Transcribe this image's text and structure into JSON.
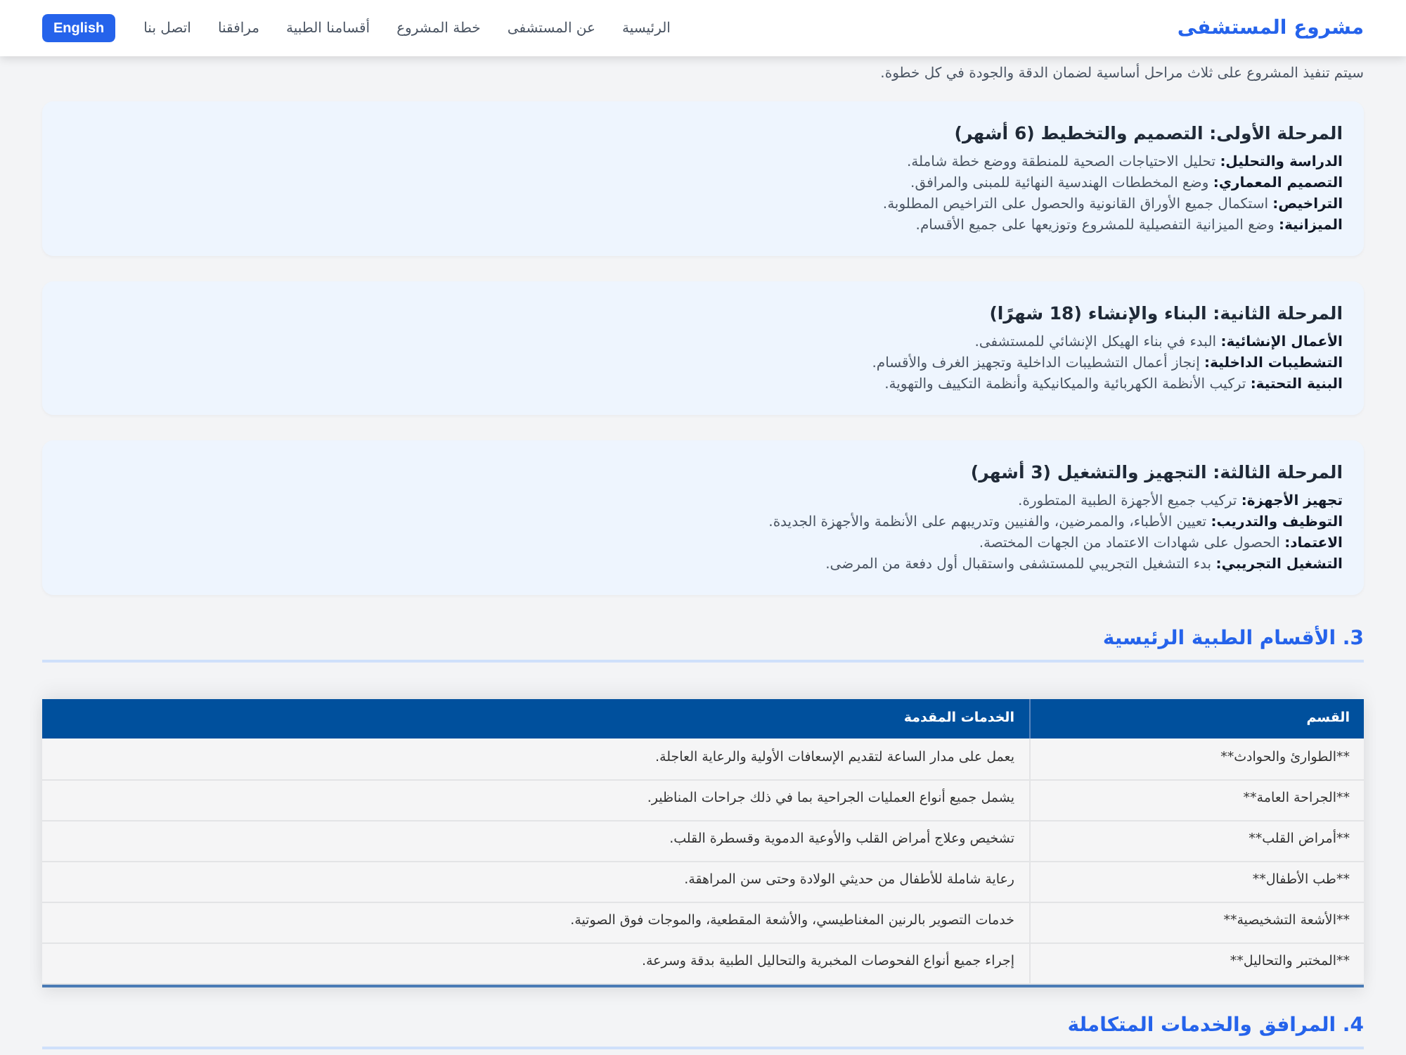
{
  "header": {
    "brand": "مشروع المستشفى",
    "nav": [
      "الرئيسية",
      "عن المستشفى",
      "خطة المشروع",
      "أقسامنا الطبية",
      "مرافقنا",
      "اتصل بنا"
    ],
    "language_button": "English"
  },
  "intro": "سيتم تنفيذ المشروع على ثلاث مراحل أساسية لضمان الدقة والجودة في كل خطوة.",
  "phases": [
    {
      "title": "المرحلة الأولى: التصميم والتخطيط (6 أشهر)",
      "tasks": [
        "**الدراسة والتحليل:** تحليل الاحتياجات الصحية للمنطقة ووضع خطة شاملة.",
        "**التصميم المعماري:** وضع المخططات الهندسية النهائية للمبنى والمرافق.",
        "**التراخيص:** استكمال جميع الأوراق القانونية والحصول على التراخيص المطلوبة.",
        "**الميزانية:** وضع الميزانية التفصيلية للمشروع وتوزيعها على جميع الأقسام."
      ]
    },
    {
      "title": "المرحلة الثانية: البناء والإنشاء (18 شهرًا)",
      "tasks": [
        "**الأعمال الإنشائية:** البدء في بناء الهيكل الإنشائي للمستشفى.",
        "**التشطيبات الداخلية:** إنجاز أعمال التشطيبات الداخلية وتجهيز الغرف والأقسام.",
        "**البنية التحتية:** تركيب الأنظمة الكهربائية والميكانيكية وأنظمة التكييف والتهوية."
      ]
    },
    {
      "title": "المرحلة الثالثة: التجهيز والتشغيل (3 أشهر)",
      "tasks": [
        "**تجهيز الأجهزة:** تركيب جميع الأجهزة الطبية المتطورة.",
        "**التوظيف والتدريب:** تعيين الأطباء، والممرضين، والفنيين وتدريبهم على الأنظمة والأجهزة الجديدة.",
        "**الاعتماد:** الحصول على شهادات الاعتماد من الجهات المختصة.",
        "**التشغيل التجريبي:** بدء التشغيل التجريبي للمستشفى واستقبال أول دفعة من المرضى."
      ]
    }
  ],
  "departments_section": {
    "heading": "3. الأقسام الطبية الرئيسية",
    "table": {
      "columns": [
        "القسم",
        "الخدمات المقدمة"
      ],
      "rows": [
        [
          "**الطوارئ والحوادث**",
          "يعمل على مدار الساعة لتقديم الإسعافات الأولية والرعاية العاجلة."
        ],
        [
          "**الجراحة العامة**",
          "يشمل جميع أنواع العمليات الجراحية بما في ذلك جراحات المناظير."
        ],
        [
          "**أمراض القلب**",
          "تشخيص وعلاج أمراض القلب والأوعية الدموية وقسطرة القلب."
        ],
        [
          "**طب الأطفال**",
          "رعاية شاملة للأطفال من حديثي الولادة وحتى سن المراهقة."
        ],
        [
          "**الأشعة التشخيصية**",
          "خدمات التصوير بالرنين المغناطيسي، والأشعة المقطعية، والموجات فوق الصوتية."
        ],
        [
          "**المختبر والتحاليل**",
          "إجراء جميع أنواع الفحوصات المخبرية والتحاليل الطبية بدقة وسرعة."
        ]
      ]
    }
  },
  "facilities_section": {
    "heading": "4. المرافق والخدمات المتكاملة"
  }
}
